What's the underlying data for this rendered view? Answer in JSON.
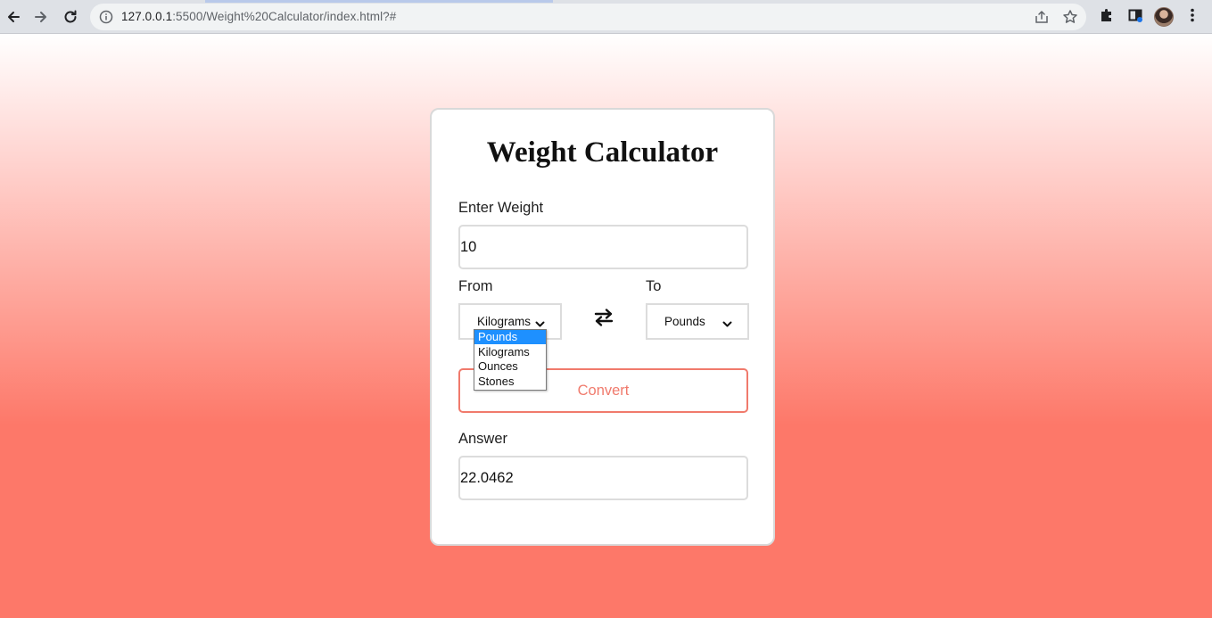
{
  "browser": {
    "url_host": "127.0.0.1",
    "url_path": ":5500/Weight%20Calculator/index.html?#"
  },
  "app": {
    "title": "Weight Calculator",
    "weight_label": "Enter Weight",
    "weight_value": "10",
    "from_label": "From",
    "to_label": "To",
    "from_selected": "Kilograms",
    "to_selected": "Pounds",
    "from_options": [
      "Pounds",
      "Kilograms",
      "Ounces",
      "Stones"
    ],
    "highlighted_option": "Pounds",
    "convert_label": "Convert",
    "answer_label": "Answer",
    "answer_value": "22.0462"
  },
  "colors": {
    "accent": "#f07a6c",
    "gradient_bottom": "#fd7869",
    "dropdown_highlight": "#1e90ff"
  },
  "icons": {
    "back": "arrow-left-icon",
    "forward": "arrow-right-icon",
    "reload": "reload-icon",
    "site_info": "info-icon",
    "share": "share-icon",
    "bookmark": "star-icon",
    "extensions": "puzzle-icon",
    "side_panel": "side-panel-icon",
    "menu": "kebab-menu-icon",
    "swap": "swap-arrows-icon",
    "select_chevron": "chevron-down-icon"
  }
}
